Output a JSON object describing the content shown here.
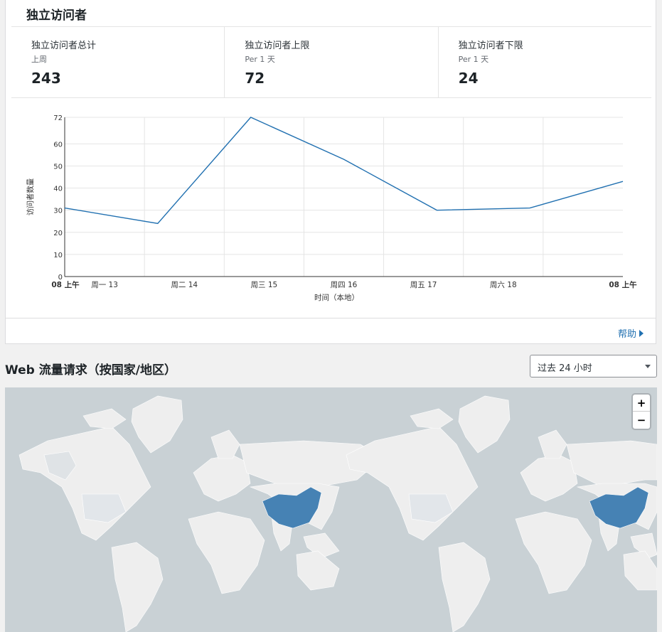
{
  "panel": {
    "title": "独立访问者",
    "stats": [
      {
        "label": "独立访问者总计",
        "sub": "上周",
        "value": "243"
      },
      {
        "label": "独立访问者上限",
        "sub": "Per 1 天",
        "value": "72"
      },
      {
        "label": "独立访问者下限",
        "sub": "Per 1 天",
        "value": "24"
      }
    ],
    "help_label": "帮助"
  },
  "chart_data": {
    "type": "line",
    "ylabel": "访问者数量",
    "xlabel": "时间（本地）",
    "ylim": [
      0,
      72
    ],
    "yticks": [
      0,
      10,
      20,
      30,
      40,
      50,
      60,
      72
    ],
    "xticks": [
      "08 上午",
      "周一 13",
      "周二 14",
      "周三 15",
      "周四 16",
      "周五 17",
      "周六 18",
      "08 上午"
    ],
    "x": [
      "08 上午",
      "周一 13",
      "周二 14",
      "周三 15",
      "周四 16",
      "周五 17",
      "周六 18",
      "08 上午"
    ],
    "values": [
      31,
      24,
      72,
      53,
      30,
      31,
      43
    ],
    "line_color": "#2271b1",
    "grid": true
  },
  "traffic": {
    "title": "Web 流量请求（按国家/地区）",
    "range_selected": "过去 24 小时"
  },
  "map": {
    "zoom_in": "+",
    "zoom_out": "−",
    "ocean_color": "#c9d1d5",
    "land_color": "#eeeeee",
    "highlight_color": "#4682b4"
  }
}
